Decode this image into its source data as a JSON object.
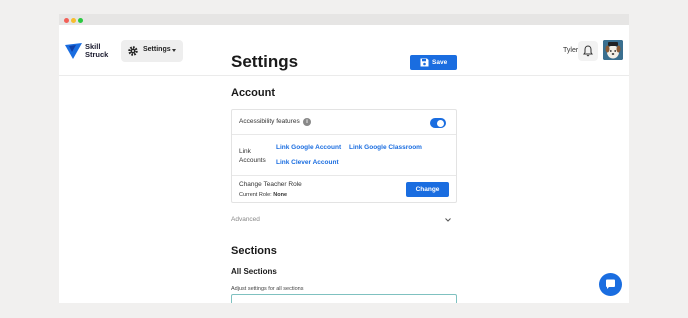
{
  "brand": {
    "logo_text_line1": "Skill",
    "logo_text_line2": "Struck",
    "accent": "#1a6de0"
  },
  "header": {
    "settings_menu_label": "Settings",
    "user_name": "Tyler"
  },
  "page": {
    "title": "Settings",
    "save_label": "Save"
  },
  "account": {
    "heading": "Account",
    "accessibility_label": "Accessibility features",
    "accessibility_enabled": true,
    "link_accounts_label_1": "Link",
    "link_accounts_label_2": "Accounts",
    "link_google": "Link Google Account",
    "link_google_classroom": "Link Google Classroom",
    "link_clever": "Link Clever Account",
    "change_role_label": "Change Teacher Role",
    "current_role_prefix": "Current Role:",
    "current_role_value": "None",
    "change_button": "Change"
  },
  "advanced": {
    "label": "Advanced"
  },
  "sections": {
    "heading": "Sections",
    "all_heading": "All Sections",
    "adjust_label": "Adjust settings for all sections"
  }
}
